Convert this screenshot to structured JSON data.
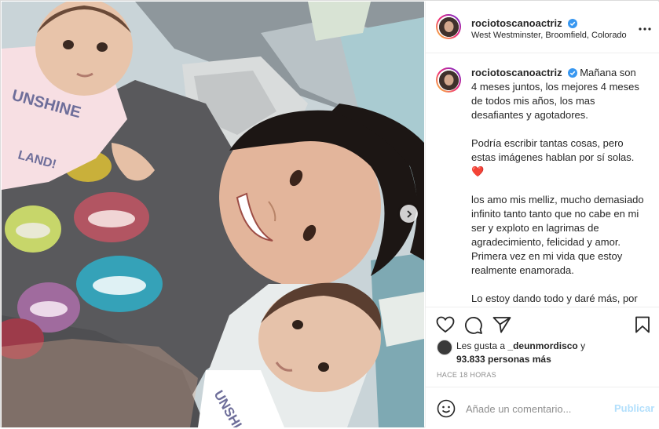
{
  "post": {
    "username": "rociotoscanoactriz",
    "verified": true,
    "location": "West Westminster, Broomfield, Colorado",
    "caption": "Mañana son 4 meses juntos, los mejores 4 meses de todos mis años, los mas desafiantes y agotadores.\n\nPodría escribir tantas cosas, pero estas imágenes hablan por sí solas. ❤️\n\nlos amo mis melliz, mucho demasiado infinito tanto tanto que no cabe en mi ser y exploto en lagrimas de agradecimiento, felicidad y amor. Primera vez en mi vida que estoy realmente enamorada.\n\nLo estoy dando todo y daré más, por uds y por mi.\n\nLos amo los amo los amo",
    "likes_prefix": "Les gusta a ",
    "liked_by": "_deunmordisco",
    "likes_and": " y",
    "likes_count": "93.833 personas más",
    "timestamp": "HACE 18 HORAS"
  },
  "comment": {
    "placeholder": "Añade un comentario...",
    "publish_label": "Publicar"
  },
  "icons": {
    "like": "heart-icon",
    "comment": "comment-icon",
    "share": "paper-plane-icon",
    "save": "bookmark-icon",
    "emoji": "smiley-icon",
    "next": "chevron-right-icon",
    "more": "more-dots-icon",
    "verified": "verified-badge-icon"
  },
  "colors": {
    "verified": "#3897f0",
    "publish_disabled": "#b2dffc",
    "muted": "#8e8e8e"
  }
}
